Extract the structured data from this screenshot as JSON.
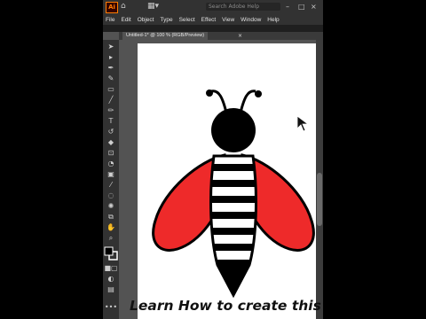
{
  "app": {
    "logo": "Ai",
    "search_placeholder": "Search Adobe Help",
    "menu": [
      "File",
      "Edit",
      "Object",
      "Type",
      "Select",
      "Effect",
      "View",
      "Window",
      "Help"
    ]
  },
  "document": {
    "tab_label": "Untitled-1* @ 100 % (RGB/Preview)",
    "close_glyph": "×"
  },
  "tools": [
    "selection-tool",
    "direct-selection-tool",
    "pen-tool",
    "curvature-tool",
    "rectangle-tool",
    "paintbrush-tool",
    "pencil-tool",
    "type-tool",
    "rotate-tool",
    "eraser-tool",
    "scale-tool",
    "shape-builder-tool",
    "gradient-tool",
    "eyedropper-tool",
    "blend-tool",
    "symbol-sprayer-tool",
    "artboard-tool",
    "hand-tool",
    "zoom-tool",
    "fill-stroke-swatch",
    "color-mode",
    "draw-mode",
    "screen-mode",
    "more-tools"
  ],
  "artwork": {
    "wing_color": "#ee2a2a",
    "body_stripe_color": "#000000",
    "subject": "bee"
  },
  "caption": "Learn How to create this"
}
